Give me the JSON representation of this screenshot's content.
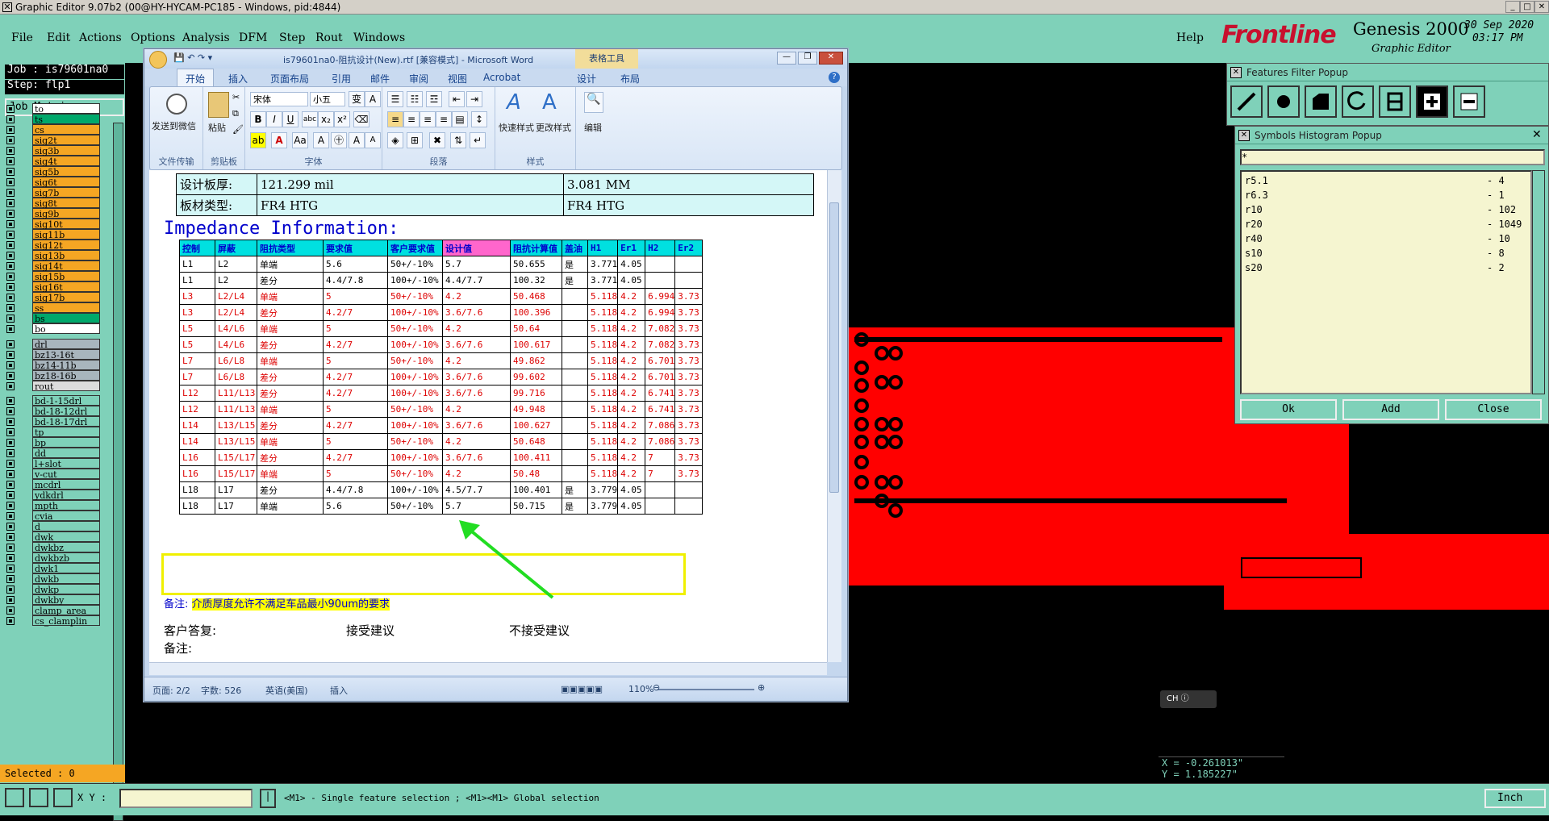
{
  "app": {
    "title": "Graphic Editor 9.07b2 (00@HY-HYCAM-PC185 - Windows, pid:4844)",
    "menu": [
      "File",
      "Edit",
      "Actions",
      "Options",
      "Analysis",
      "DFM",
      "Step",
      "Rout",
      "Windows"
    ],
    "help": "Help",
    "brand": "Frontline",
    "product": "Genesis 2000",
    "product_sub": "Graphic Editor",
    "date": "30 Sep 2020",
    "time": "03:17 PM"
  },
  "job": {
    "job_label": "Job : is79601na0",
    "step_label": "Step: flp1",
    "matrix_button": "Job Matrix ...",
    "selected": "Selected : 0"
  },
  "layers_group1": [
    {
      "name": "to",
      "color": "#ffffff"
    },
    {
      "name": "ts",
      "color": "#00a86b"
    },
    {
      "name": "cs",
      "color": "#f5a623"
    },
    {
      "name": "sig2t",
      "color": "#f5a623"
    },
    {
      "name": "sig3b",
      "color": "#f5a623"
    },
    {
      "name": "sig4t",
      "color": "#f5a623"
    },
    {
      "name": "sig5b",
      "color": "#f5a623"
    },
    {
      "name": "sig6t",
      "color": "#f5a623"
    },
    {
      "name": "sig7b",
      "color": "#f5a623"
    },
    {
      "name": "sig8t",
      "color": "#f5a623"
    },
    {
      "name": "sig9b",
      "color": "#f5a623"
    },
    {
      "name": "sig10t",
      "color": "#f5a623"
    },
    {
      "name": "sig11b",
      "color": "#f5a623"
    },
    {
      "name": "sig12t",
      "color": "#f5a623"
    },
    {
      "name": "sig13b",
      "color": "#f5a623"
    },
    {
      "name": "sig14t",
      "color": "#f5a623"
    },
    {
      "name": "sig15b",
      "color": "#f5a623"
    },
    {
      "name": "sig16t",
      "color": "#f5a623"
    },
    {
      "name": "sig17b",
      "color": "#f5a623"
    },
    {
      "name": "ss",
      "color": "#f5a623"
    },
    {
      "name": "bs",
      "color": "#00a86b"
    },
    {
      "name": "bo",
      "color": "#ffffff"
    }
  ],
  "layers_group2": [
    {
      "name": "drl",
      "color": "#a8b5bd"
    },
    {
      "name": "bz13-16t",
      "color": "#a8b5bd"
    },
    {
      "name": "bz14-11b",
      "color": "#a8b5bd"
    },
    {
      "name": "bz18-16b",
      "color": "#a8b5bd"
    },
    {
      "name": "rout",
      "color": "#dcdcdc"
    }
  ],
  "layers_group3": [
    {
      "name": "bd-1-15drl",
      "color": "#7fd1b9"
    },
    {
      "name": "bd-18-12drl",
      "color": "#7fd1b9"
    },
    {
      "name": "bd-18-17drl",
      "color": "#7fd1b9"
    },
    {
      "name": "tp",
      "color": "#7fd1b9"
    },
    {
      "name": "bp",
      "color": "#7fd1b9"
    },
    {
      "name": "dd",
      "color": "#7fd1b9"
    },
    {
      "name": "l+slot",
      "color": "#7fd1b9"
    },
    {
      "name": "v-cut",
      "color": "#7fd1b9"
    },
    {
      "name": "mcdrl",
      "color": "#7fd1b9"
    },
    {
      "name": "ydkdrl",
      "color": "#7fd1b9"
    },
    {
      "name": "mpth",
      "color": "#7fd1b9"
    },
    {
      "name": "cvia",
      "color": "#7fd1b9"
    },
    {
      "name": "d",
      "color": "#7fd1b9"
    },
    {
      "name": "dwk",
      "color": "#7fd1b9"
    },
    {
      "name": "dwkbz",
      "color": "#7fd1b9"
    },
    {
      "name": "dwkbzb",
      "color": "#7fd1b9"
    },
    {
      "name": "dwk1",
      "color": "#7fd1b9"
    },
    {
      "name": "dwkb",
      "color": "#7fd1b9"
    },
    {
      "name": "dwkp",
      "color": "#7fd1b9"
    },
    {
      "name": "dwkby",
      "color": "#7fd1b9"
    },
    {
      "name": "clamp_area",
      "color": "#7fd1b9"
    },
    {
      "name": "cs_clamplin",
      "color": "#7fd1b9"
    }
  ],
  "status": {
    "xy_label": "X Y :",
    "hint": "<M1> - Single feature selection ; <M1><M1> Global selection",
    "unit": "Inch",
    "x": "X = -0.261013\"",
    "y": "Y =  1.185227\""
  },
  "features_popup": {
    "title": "Features Filter Popup"
  },
  "symbols_popup": {
    "title": "Symbols Histogram Popup",
    "filter": "*",
    "items": [
      {
        "sym": "r5.1",
        "count": "4"
      },
      {
        "sym": "r6.3",
        "count": "1"
      },
      {
        "sym": "r10",
        "count": "102"
      },
      {
        "sym": "r20",
        "count": "1049"
      },
      {
        "sym": "r40",
        "count": "10"
      },
      {
        "sym": "s10",
        "count": "8"
      },
      {
        "sym": "s20",
        "count": "2"
      }
    ],
    "ok": "Ok",
    "add": "Add",
    "close": "Close"
  },
  "word": {
    "title": "is79601na0-阻抗设计(New).rtf [兼容模式] - Microsoft Word",
    "tools_tab": "表格工具",
    "tabs": [
      "开始",
      "插入",
      "页面布局",
      "引用",
      "邮件",
      "审阅",
      "视图",
      "Acrobat",
      "设计",
      "布局"
    ],
    "groups": {
      "send": "发送到微信",
      "send_group": "文件传输",
      "paste": "粘贴",
      "clipboard": "剪贴板",
      "font_name": "宋体",
      "font_size": "小五",
      "font": "字体",
      "paragraph": "段落",
      "quick_style": "快速样式",
      "change_style": "更改样式",
      "styles": "样式",
      "edit": "编辑"
    },
    "info_rows": [
      {
        "label": "设计板厚:",
        "v1": "121.299 mil",
        "v2": "3.081 MM"
      },
      {
        "label": "板材类型:",
        "v1": "FR4 HTG",
        "v2": "FR4 HTG"
      }
    ],
    "section_title": "Impedance Information:",
    "headers": [
      "控制",
      "屏蔽",
      "阻抗类型",
      "要求值",
      "客户要求值",
      "设计值",
      "阻抗计算值",
      "盖油",
      "H1",
      "Er1",
      "H2",
      "Er2"
    ],
    "rows": [
      [
        "L1",
        "L2",
        "单端",
        "5.6",
        "50+/-10%",
        "5.7",
        "50.655",
        "是",
        "3.771",
        "4.05",
        "",
        ""
      ],
      [
        "L1",
        "L2",
        "差分",
        "4.4/7.8",
        "100+/-10%",
        "4.4/7.7",
        "100.32",
        "是",
        "3.771",
        "4.05",
        "",
        ""
      ],
      [
        "L3",
        "L2/L4",
        "单端",
        "5",
        "50+/-10%",
        "4.2",
        "50.468",
        "",
        "5.118",
        "4.2",
        "6.994",
        "3.73"
      ],
      [
        "L3",
        "L2/L4",
        "差分",
        "4.2/7",
        "100+/-10%",
        "3.6/7.6",
        "100.396",
        "",
        "5.118",
        "4.2",
        "6.994",
        "3.73"
      ],
      [
        "L5",
        "L4/L6",
        "单端",
        "5",
        "50+/-10%",
        "4.2",
        "50.64",
        "",
        "5.118",
        "4.2",
        "7.082",
        "3.73"
      ],
      [
        "L5",
        "L4/L6",
        "差分",
        "4.2/7",
        "100+/-10%",
        "3.6/7.6",
        "100.617",
        "",
        "5.118",
        "4.2",
        "7.082",
        "3.73"
      ],
      [
        "L7",
        "L6/L8",
        "单端",
        "5",
        "50+/-10%",
        "4.2",
        "49.862",
        "",
        "5.118",
        "4.2",
        "6.701",
        "3.73"
      ],
      [
        "L7",
        "L6/L8",
        "差分",
        "4.2/7",
        "100+/-10%",
        "3.6/7.6",
        "99.602",
        "",
        "5.118",
        "4.2",
        "6.701",
        "3.73"
      ],
      [
        "L12",
        "L11/L13",
        "差分",
        "4.2/7",
        "100+/-10%",
        "3.6/7.6",
        "99.716",
        "",
        "5.118",
        "4.2",
        "6.741",
        "3.73"
      ],
      [
        "L12",
        "L11/L13",
        "单端",
        "5",
        "50+/-10%",
        "4.2",
        "49.948",
        "",
        "5.118",
        "4.2",
        "6.741",
        "3.73"
      ],
      [
        "L14",
        "L13/L15",
        "差分",
        "4.2/7",
        "100+/-10%",
        "3.6/7.6",
        "100.627",
        "",
        "5.118",
        "4.2",
        "7.086",
        "3.73"
      ],
      [
        "L14",
        "L13/L15",
        "单端",
        "5",
        "50+/-10%",
        "4.2",
        "50.648",
        "",
        "5.118",
        "4.2",
        "7.086",
        "3.73"
      ],
      [
        "L16",
        "L15/L17",
        "差分",
        "4.2/7",
        "100+/-10%",
        "3.6/7.6",
        "100.411",
        "",
        "5.118",
        "4.2",
        "7",
        "3.73"
      ],
      [
        "L16",
        "L15/L17",
        "单端",
        "5",
        "50+/-10%",
        "4.2",
        "50.48",
        "",
        "5.118",
        "4.2",
        "7",
        "3.73"
      ],
      [
        "L18",
        "L17",
        "差分",
        "4.4/7.8",
        "100+/-10%",
        "4.5/7.7",
        "100.401",
        "是",
        "3.779",
        "4.05",
        "",
        ""
      ],
      [
        "L18",
        "L17",
        "单端",
        "5.6",
        "50+/-10%",
        "5.7",
        "50.715",
        "是",
        "3.779",
        "4.05",
        "",
        ""
      ]
    ],
    "note_label": "备注:",
    "note_text": "介质厚度允许不满足车品最小90um的要求",
    "reply_label": "客户答复:",
    "accept": "接受建议",
    "reject": "不接受建议",
    "note2": "备注:",
    "status_page": "页面: 2/2",
    "status_words": "字数: 526",
    "status_lang": "英语(美国)",
    "status_insert": "插入",
    "zoom": "110%"
  }
}
